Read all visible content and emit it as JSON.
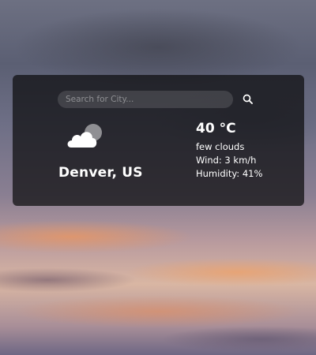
{
  "search": {
    "placeholder": "Search for City..."
  },
  "weather": {
    "icon": "few-clouds-icon",
    "city": "Denver, US",
    "temperature": "40 °C",
    "description": "few clouds",
    "wind": "Wind: 3 km/h",
    "humidity": "Humidity: 41%"
  },
  "colors": {
    "card_background": "#0c0c0e",
    "text": "#ffffff",
    "search_background": "#3a3a3c"
  }
}
